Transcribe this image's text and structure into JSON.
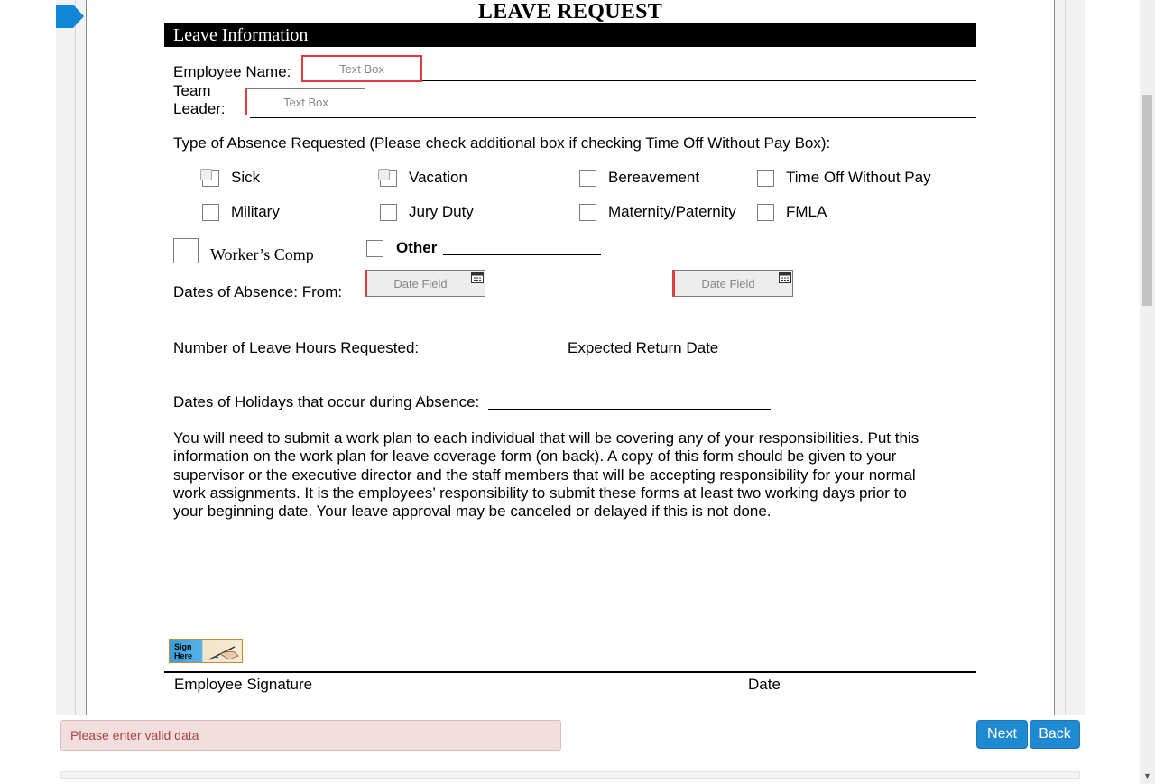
{
  "form": {
    "title": "LEAVE REQUEST",
    "section_title": "Leave Information",
    "employee_name_label": "Employee Name:",
    "employee_name_placeholder": "Text Box",
    "team_leader_label_line1": "Team",
    "team_leader_label_line2": "Leader:",
    "team_leader_placeholder": "Text Box",
    "absence_type_prompt": "Type of Absence Requested (Please check additional box if checking Time Off Without Pay Box):",
    "absence_options": [
      "Sick",
      "Vacation",
      "Bereavement",
      "Time Off Without Pay",
      "Military",
      "Jury Duty",
      "Maternity/Paternity",
      "FMLA"
    ],
    "workers_comp_label": "Worker’s Comp",
    "other_label": "Other",
    "dates_absence_label": "Dates of Absence: From:",
    "date_from_placeholder": "Date Field",
    "date_to_placeholder": "Date Field",
    "leave_hours_label": "Number of Leave Hours Requested:",
    "expected_return_label": "Expected Return Date",
    "holidays_label": "Dates of Holidays that occur during Absence:",
    "instructions_lines": [
      "You will need to submit a work plan to each individual that will be covering any of your responsibilities.  Put this",
      "information on the work plan for leave coverage form (on back).  A copy of this form should be given to your",
      "supervisor or the executive director and the staff members that will be accepting responsibility for your normal",
      "work assignments.  It is the employees’ responsibility to submit these forms at least two working days prior to",
      "your beginning date.  Your leave approval may be canceled or delayed if this is not done."
    ],
    "sign_here_line1": "Sign",
    "sign_here_line2": "Here",
    "employee_signature_label": "Employee Signature",
    "date_label": "Date"
  },
  "footer": {
    "error_message": "Please enter valid data",
    "next_label": "Next",
    "back_label": "Back"
  },
  "colors": {
    "accent": "#1f8ad1",
    "error": "#e03a3a",
    "alert_bg": "#f2dede",
    "alert_text": "#a94442"
  },
  "icons": {
    "current_field_marker": "arrow-right-icon",
    "date_picker": "calendar-icon",
    "signature": "sign-here-icon",
    "scroll_down": "chevron-down-icon"
  }
}
